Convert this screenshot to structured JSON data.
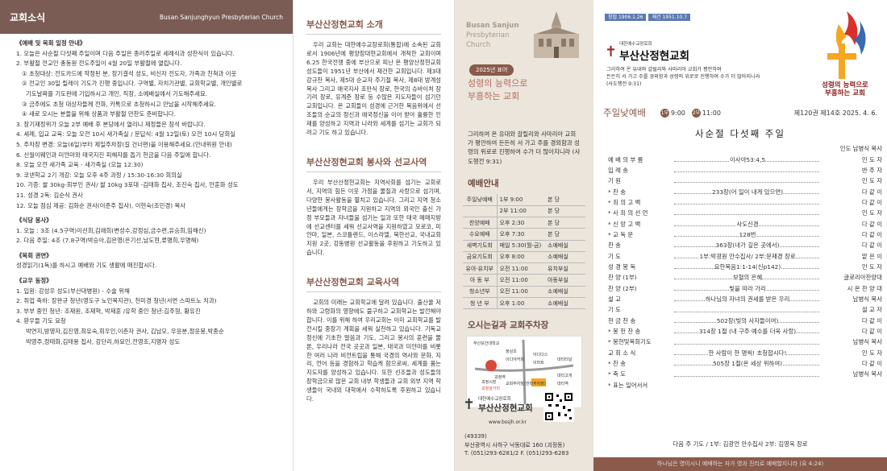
{
  "p1": {
    "title": "교회소식",
    "subtitle": "Busan Sanjunghyun Presbyterian Church",
    "lines": [
      {
        "t": "《예배 및 목회 일정 안내》",
        "cls": "sec"
      },
      {
        "t": "1. 오늘은 사순절 다섯째 주일이며 다음 주일은 종려주일로 세례식과 성찬식이 있습니다.",
        "cls": ""
      },
      {
        "t": "2. 부활절 전교인 총동원 전도주일이 4월 20일 부활절에 열립니다.",
        "cls": ""
      },
      {
        "t": "① 초청대상: 전도카드에 작정된 분, 장기결석 성도, 비신자 전도자, 가족과 친척과 이웃",
        "cls": "ind"
      },
      {
        "t": "② 전교인 30일 릴레이 기도가 진행 중입니다. 구역별, 자치기관별, 교회학교별, 개인별로",
        "cls": "ind"
      },
      {
        "t": "기도날짜를 기도판에 기입하시고 개인, 직장, 소예배실에서 기도해주세요.",
        "cls": "ind2"
      },
      {
        "t": "③ 금주에도 초청 대상자들께 전화, 카톡으로 초청하시고 만남을 시작해주세요.",
        "cls": "ind"
      },
      {
        "t": "④ 새로 오시는 분들을 위해 상품과 부활절 만찬도 준비합니다.",
        "cls": "ind"
      },
      {
        "t": "3. 장기재정위가 오늘 2부 예배 후 본당에서 열리니 재정들은 참석 바랍니다.",
        "cls": ""
      },
      {
        "t": "4. 세례, 입교 교육: 오늘 오전 10시 새가족실 / 문답식: 4월 12일(토) 오전 10시 당회실",
        "cls": ""
      },
      {
        "t": "5. 주차장 변경: 오늘(6일)부터 제일주차장(길 건너편)을 이용해주세요.(안내위원 안내)",
        "cls": ""
      },
      {
        "t": "6. 신월이웨인과 미얀마와 태국지진 피해자를 돕기 헌금을 다음 주일에 합니다.",
        "cls": ""
      },
      {
        "t": "8. 오늘 오전 새가족 교육 - 새가족실 (오늘 12:30)",
        "cls": ""
      },
      {
        "t": "9. 코넨학교 2기 개강: 오늘 오후 4주 과정 / 15:30-16:30 회의실",
        "cls": ""
      },
      {
        "t": "10. 기증: 쌀 30kg-회부인 권사/ 쌀 10kg 3포대 -김태화 집사, 조진숙 집사, 안훈화 성도",
        "cls": ""
      },
      {
        "t": "11. 성경 2독: 김순식 권사",
        "cls": ""
      },
      {
        "t": "12. 오늘 점심 제공: 김화순 권사(이준주 집사), 이현숙(조민경) 목사",
        "cls": ""
      },
      {
        "t": "《식당 봉사》",
        "cls": "sec"
      },
      {
        "t": "1. 오늘 : 3조 (4.5구역)이선희,김애희(변성수,강정심,금수련,유승희,임해신)",
        "cls": ""
      },
      {
        "t": "2. 다음 주일: 4조 (7.8구역)박승아,김은영(은기선,남도현,류명희,우명해)",
        "cls": ""
      },
      {
        "t": "《목회 권면》",
        "cls": "sec"
      },
      {
        "t": "성경읽기(1독)를 하시고 예배와 기도 생활에 매진합시다.",
        "cls": ""
      },
      {
        "t": "《교우 동정》",
        "cls": "sec"
      },
      {
        "t": "1. 입원: 강성우 성도(부산대병원) - 수술 위해",
        "cls": ""
      },
      {
        "t": "2. 취업 축하: 장완규 청년(영도구 노인복지관), 천미경 청년(서면 스파트노 치과)",
        "cls": ""
      },
      {
        "t": "3. 부부 중인 청년: 조재원, 조재혁, 박재훈 /유학 중인 청년:김주형, 황유진",
        "cls": ""
      },
      {
        "t": "4. 환우들 기도 요청",
        "cls": ""
      },
      {
        "t": "박연지,방영자,김진영,최유숙,회우인,이춘자 권사, 김남모, 우윤분,정윤봉,박종순",
        "cls": "ind2"
      },
      {
        "t": "박영주,정태화,김태용 집사, 강단리,하요인,전영조,지명자 성도",
        "cls": "ind2"
      }
    ]
  },
  "p2": {
    "s1_title": "부산산정현교회 소개",
    "s1_text": "우리 교회는 대한예수교장로회(통합)에 소속된 교회로서 1906년에 평양장대현교회에서 개척한 교회이며 6.25 한국전쟁 중에 부산으로 피난 온 평양산정현교회 성도들이 1951년 부산에서 재건한 교회입니다. 제3대 강규찬 목사, 제5대 순교자 주기철 목사, 제8대 방계성 목사 그리고 애국지사 조만식 장로, 한국의 슈바이처 장기려 장로, 유계준 장로 등 수많은 지도자들이 섬기던 교회입니다. 온 교회들이 성경에 근거한 복음위에서 선조들의 순교의 정신과 애국정신을 이어 받아 훌륭한 인재를 양성하고 지역과 나라와 세계를 섬기는 교회가 되려고 기도 하고 있습니다.",
    "s2_title": "부산산정현교회 봉사와 선교사역",
    "s2_text": "우리 부산산정현교회는 지역사회를 섬기는 교회로서, 지역의 힘든 이웃 가정을 물질과 사랑으로 섬기며, 다양한 봉사활동을 펼치고 있습니다. 그리고 지역 청소년들에게는 장학금을 지원하고 지역의 외국인 출신 가정 부모들과 자녀들을 섬기는 일과 또한 태국 메매지방에 선교센터를 세워 선교사역을 지원하였고 모로코, 미얀마, 일본, 스코틀랜드, 이스라엘, 북한선교, 국내교회 지원 2곳, 강동병원 선교활동을 후원하고 기도하고 있습니다.",
    "s3_title": "부산산정현교회 교육사역",
    "s3_text": "교회의 미래는 교회학교에 달려 있습니다. 출산율 저하와 고령화의 영향에도 불구하고 교회학교는 발전해야합니다. 이를 위해 하여 우리교회는 이미 교회학교를 발전시킬 중장기 계획을 세워 실천하고 있습니다. 기독교 정신에 기초한 말씀과 기도, 그리고 봉사의 훈련을 물론, 우리나라 전국 곳곳과 일본, 태국과 미얀마를 비롯한 여러 나라 비전트립을 통해 국경의 역사와 문화, 지리, 언어 등을 경험하고 학습케 함으로써, 세계를 품는 지도자를 양성하고 있습니다. 또한 선조들과 성도들의 장학금으로 많은 교회 내부 학생들과 교회 외부 지역 학생들이 국내외 대학에서 수학하도록 후원하고 있습니다."
  },
  "p3": {
    "en1": "Busan Sanjunghyun",
    "en2": "Presbyterian",
    "en3": "Church",
    "badge": "2025년 표어",
    "slogan1": "성령의 능력으로",
    "slogan2": "부흥하는 교회",
    "verse": "그리하여 온 유대와 갈릴리와 사마리아 교회가 평안하여 든든히 서 가고 주를 경외함과 성령의 위로로 진행하여 수가 더 많아지니라 (사도행전 9:31)",
    "worship_title": "예배안내",
    "worship": [
      [
        "주일낮예배",
        "1부 9:00",
        "본 당"
      ],
      [
        "",
        "2부 11:00",
        "본 당"
      ],
      [
        "찬양예배",
        "오후 2:30",
        "본 당"
      ],
      [
        "수요예배",
        "오후 7:30",
        "본 당"
      ],
      [
        "새벽기도회",
        "매일 5:30(월-금)",
        "소예배실"
      ],
      [
        "금요기도회",
        "오후 8:00",
        "소예배실"
      ],
      [
        "유아·유치부",
        "오전 11:00",
        "유치부실"
      ],
      [
        "아 동 부",
        "오전 11:00",
        "아동부실"
      ],
      [
        "청소년부",
        "오전 11:00",
        "소예배실"
      ],
      [
        "청 년 부",
        "오후 1:00",
        "소예배실"
      ]
    ],
    "map_title": "오시는길과 교회주차장",
    "map_labels": [
      "부산보건대학교",
      "부산산정현교회",
      "정상초",
      "이디아커피",
      "대티터널",
      "괴정시장",
      "괴정삼거리",
      "아디다스",
      "괴정역",
      "교회주차장(한라주차장)",
      "대티역",
      "대티고개",
      "이마트"
    ],
    "logo_small": "대한예수교장로회",
    "logo_name": "부산산정현교회",
    "web": "www.bssjh.or.kr",
    "addr1": "(49339)",
    "addr2": "부산광역시 사하구 낙동대로 160 (괴정동)",
    "addr3": "T. (051)293-6281/2 F. (051)293-6283"
  },
  "p4": {
    "tag_a": "창립 1906.1.26",
    "tag_b": "재건 1951.10.7",
    "brand_small": "대한예수교장로회",
    "brand_name": "부산산정현교회",
    "verse1": "그리하여 온 유대와 갈릴리와 사마리아 교회가 평안하여",
    "verse2": "든든히 서 가고 주를 경외함과 성령의 위로로 진행하여 수가 더 많아지니라",
    "verse3": "(사도행전 9:31)",
    "logo_text1": "성령의 능력으로",
    "logo_text2": "부흥하는 교회",
    "worship_label": "주일낮예배",
    "c1": "1부",
    "t1": "9:00",
    "c2": "2부",
    "t2": "11:00",
    "issue": "제120권  제14호  2025. 4. 6.",
    "sunday": "사순절 다섯째 주일",
    "leader": "인도 남병식 목사",
    "rows": [
      [
        "예 배 의 부 름",
        "이사야53:4,5",
        "인 도 자"
      ],
      [
        "입      례      송",
        "",
        "반 주 자"
      ],
      [
        "기            원",
        "",
        "인 도 자"
      ],
      [
        "* 찬            송",
        "233장(어 일이 내게 있으면)",
        "다 같 이"
      ],
      [
        "* 죄 의 고 백",
        "",
        "다 같 이"
      ],
      [
        "* 사 죄 의 선 언",
        "",
        "인 도 자"
      ],
      [
        "* 신 앙 고 백",
        "사도신경",
        "다 같 이"
      ],
      [
        "* 교      독      문",
        "128번",
        "다 같 이"
      ],
      [
        "찬            송",
        "363장(내가 깊은 곳에서)",
        "다 같 이"
      ],
      [
        "기            도",
        "1부:박광원 안수집사/ 2부:문재경 장로",
        "맡 은 이"
      ],
      [
        "성 경 봉 독",
        "요한복음1:1-14(신p142)",
        "인 도 자"
      ],
      [
        "찬 양 (1부)",
        "보혈의 은혜",
        "글로리아찬양대"
      ],
      [
        "찬 양 (2부)",
        "빛을 따라 가리",
        "시 온 찬 양 대"
      ],
      [
        "설            교",
        "하나님의 자녀의 권세를 받은 우리",
        "남병식 목사"
      ],
      [
        "기            도",
        "",
        "설 교 자"
      ],
      [
        "헌   금   찬   송",
        "502장(빛의 사자들이여)",
        "다 같 이"
      ],
      [
        "* 봉   헌   찬   송",
        "314장 1절 (내 구주 예수를 더욱 사랑)",
        "다 같 이"
      ],
      [
        "* 봉헌및목회기도",
        "",
        "남병식 목사"
      ],
      [
        "교  회  소  식",
        "한 사람이 한 명씩! 초청합시다!",
        "인 도 자"
      ],
      [
        "* 찬            송",
        "505장 1절(온 세상 위하여)",
        "다 같 이"
      ],
      [
        "* 축            도",
        "",
        "남병식 목사"
      ],
      [
        "* 표는 일어서서",
        "",
        ""
      ]
    ],
    "next_week": "다음 주 기도 / 1부: 김광언 안수집사   2부: 김영욱 장로",
    "footer": "하나님은 영이시니 예배하는 자가 영과 진리로 예배할지니라 (요 4:24)"
  }
}
